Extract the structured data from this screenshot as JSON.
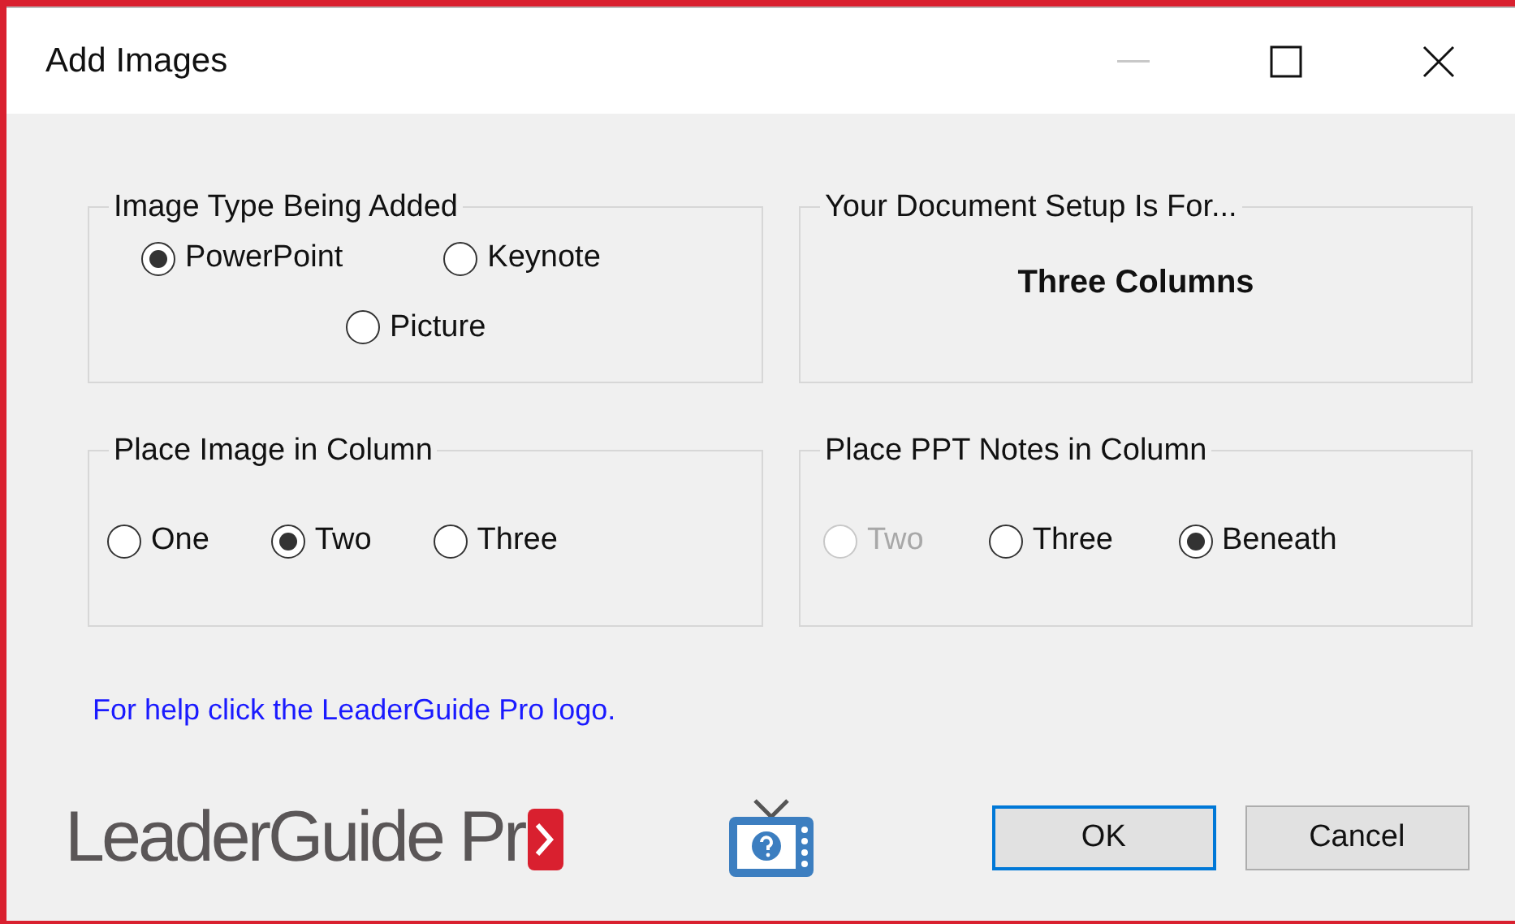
{
  "window": {
    "title": "Add Images"
  },
  "image_type": {
    "title": "Image Type Being Added",
    "options": [
      {
        "label": "PowerPoint",
        "selected": true,
        "disabled": false
      },
      {
        "label": "Keynote",
        "selected": false,
        "disabled": false
      },
      {
        "label": "Picture",
        "selected": false,
        "disabled": false
      }
    ]
  },
  "document_setup": {
    "title": "Your Document Setup Is For...",
    "value": "Three Columns"
  },
  "image_column": {
    "title": "Place Image in Column",
    "options": [
      {
        "label": "One",
        "selected": false,
        "disabled": false
      },
      {
        "label": "Two",
        "selected": true,
        "disabled": false
      },
      {
        "label": "Three",
        "selected": false,
        "disabled": false
      }
    ]
  },
  "notes_column": {
    "title": "Place PPT Notes in Column",
    "options": [
      {
        "label": "Two",
        "selected": false,
        "disabled": true
      },
      {
        "label": "Three",
        "selected": false,
        "disabled": false
      },
      {
        "label": "Beneath",
        "selected": true,
        "disabled": false
      }
    ]
  },
  "help_text": "For help click the LeaderGuide Pro logo.",
  "logo": {
    "text": "LeaderGuide Pr"
  },
  "buttons": [
    {
      "label": "OK",
      "default": true
    },
    {
      "label": "Cancel",
      "default": false
    }
  ]
}
